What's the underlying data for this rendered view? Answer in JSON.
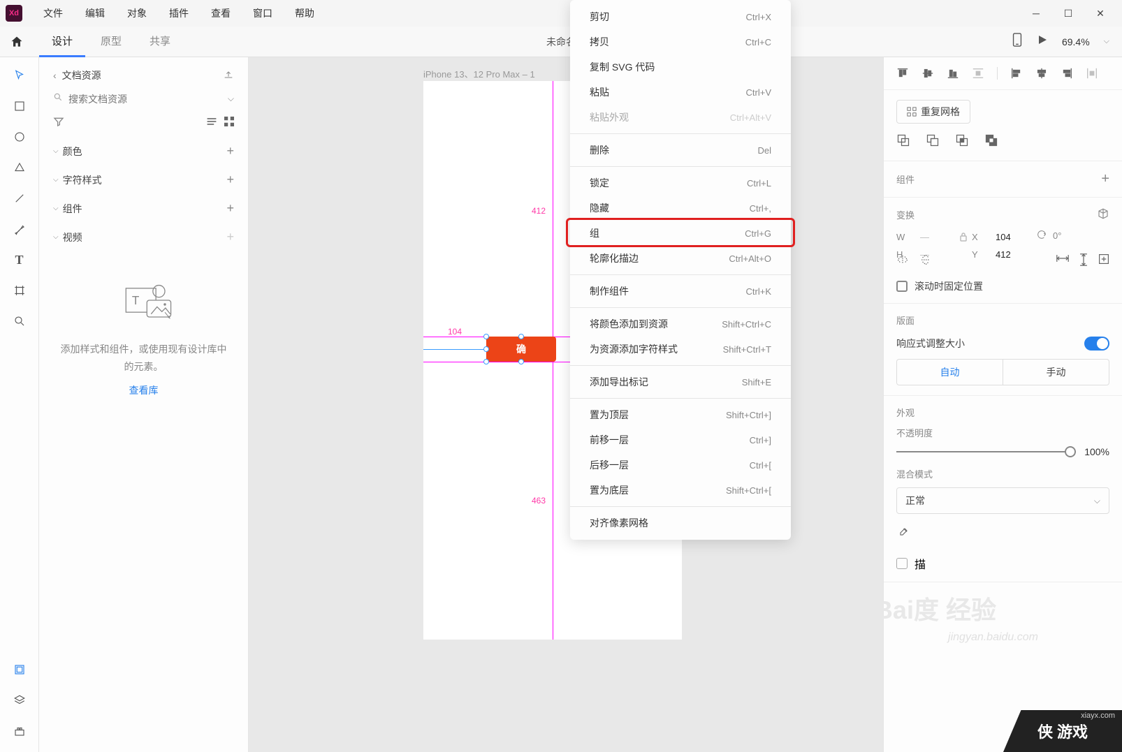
{
  "app_icon": "Xd",
  "menu": [
    "文件",
    "编辑",
    "对象",
    "插件",
    "查看",
    "窗口",
    "帮助"
  ],
  "tabs": {
    "design": "设计",
    "prototype": "原型",
    "share": "共享"
  },
  "doc_title": "未命名",
  "zoom": "69.4%",
  "left_panel": {
    "title": "文档资源",
    "search_placeholder": "搜索文档资源",
    "sections": {
      "colors": "颜色",
      "char_styles": "字符样式",
      "components": "组件",
      "video": "视频"
    },
    "empty_text": "添加样式和组件，或使用现有设计库中的元素。",
    "empty_link": "查看库"
  },
  "artboard": {
    "label": "iPhone 13、12 Pro Max – 1",
    "meas_top": "412",
    "meas_left": "104",
    "meas_bottom": "463",
    "button_text": "确"
  },
  "context_menu": [
    {
      "label": "剪切",
      "shortcut": "Ctrl+X"
    },
    {
      "label": "拷贝",
      "shortcut": "Ctrl+C"
    },
    {
      "label": "复制 SVG 代码",
      "shortcut": ""
    },
    {
      "label": "粘贴",
      "shortcut": "Ctrl+V"
    },
    {
      "label": "粘贴外观",
      "shortcut": "Ctrl+Alt+V",
      "disabled": true
    },
    {
      "sep": true
    },
    {
      "label": "删除",
      "shortcut": "Del"
    },
    {
      "sep": true
    },
    {
      "label": "锁定",
      "shortcut": "Ctrl+L"
    },
    {
      "label": "隐藏",
      "shortcut": "Ctrl+,"
    },
    {
      "label": "组",
      "shortcut": "Ctrl+G",
      "highlight": true
    },
    {
      "label": "轮廓化描边",
      "shortcut": "Ctrl+Alt+O"
    },
    {
      "sep": true
    },
    {
      "label": "制作组件",
      "shortcut": "Ctrl+K"
    },
    {
      "sep": true
    },
    {
      "label": "将颜色添加到资源",
      "shortcut": "Shift+Ctrl+C"
    },
    {
      "label": "为资源添加字符样式",
      "shortcut": "Shift+Ctrl+T"
    },
    {
      "sep": true
    },
    {
      "label": "添加导出标记",
      "shortcut": "Shift+E"
    },
    {
      "sep": true
    },
    {
      "label": "置为顶层",
      "shortcut": "Shift+Ctrl+]"
    },
    {
      "label": "前移一层",
      "shortcut": "Ctrl+]"
    },
    {
      "label": "后移一层",
      "shortcut": "Ctrl+["
    },
    {
      "label": "置为底层",
      "shortcut": "Shift+Ctrl+["
    },
    {
      "sep": true
    },
    {
      "label": "对齐像素网格",
      "shortcut": ""
    }
  ],
  "right_panel": {
    "repeat_grid": "重复网格",
    "component": "组件",
    "transform": "变换",
    "w": "W",
    "h": "H",
    "x": "X",
    "y": "Y",
    "x_val": "104",
    "y_val": "412",
    "rot": "0°",
    "fix_scroll": "滚动时固定位置",
    "layout": "版面",
    "responsive": "响应式调整大小",
    "auto": "自动",
    "manual": "手动",
    "appearance": "外观",
    "opacity_label": "不透明度",
    "opacity_val": "100%",
    "blend": "混合模式",
    "blend_val": "正常",
    "border_label": "描"
  },
  "watermark": {
    "baidu": "Bai",
    "jingyan": "经验",
    "url": "jingyan.baidu.com",
    "corner": "侠 游戏",
    "corner_url": "xiayx.com"
  }
}
